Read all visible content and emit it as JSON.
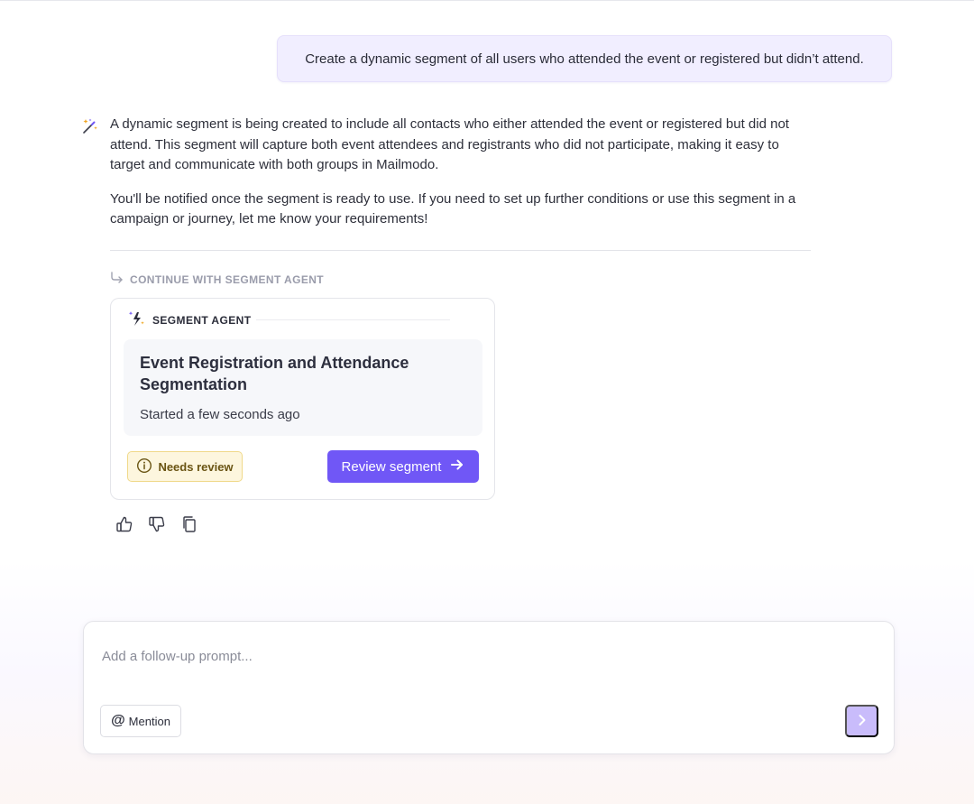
{
  "user_message": "Create a dynamic segment of all users who attended the event or registered but didn’t attend.",
  "assistant": {
    "icon": "magic-wand-icon",
    "paragraphs": [
      "A dynamic segment is being created to include all contacts who either attended the event or registered but did not attend. This segment will capture both event attendees and registrants who did not participate, making it easy to target and communicate with both groups in Mailmodo.",
      "You'll be notified once the segment is ready to use. If you need to set up further conditions or use this segment in a campaign or journey, let me know your requirements!"
    ],
    "continue_label": "CONTINUE WITH SEGMENT AGENT"
  },
  "agent_card": {
    "header": "SEGMENT AGENT",
    "title": "Event Registration and Attendance Segmentation",
    "subtitle": "Started a few seconds ago",
    "status_badge": "Needs review",
    "action_label": "Review segment"
  },
  "feedback": {
    "icons": [
      "thumbs-up-icon",
      "thumbs-down-icon",
      "copy-icon"
    ]
  },
  "composer": {
    "placeholder": "Add a follow-up prompt...",
    "mention_label": "Mention",
    "mention_symbol": "@"
  },
  "colors": {
    "accent": "#7057f6",
    "send_disabled": "#c9bcfb",
    "user_bubble": "#f1eeff",
    "badge_bg": "#fdf6de"
  }
}
